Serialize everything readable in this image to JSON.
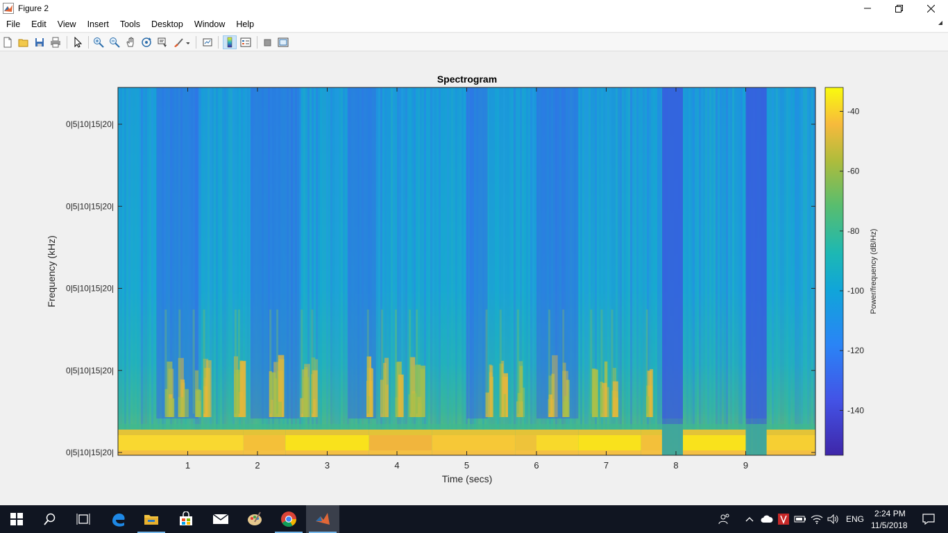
{
  "window": {
    "title": "Figure 2"
  },
  "menu": {
    "items": [
      "File",
      "Edit",
      "View",
      "Insert",
      "Tools",
      "Desktop",
      "Window",
      "Help"
    ]
  },
  "toolbar": {
    "icons": [
      "new-figure-icon",
      "open-file-icon",
      "save-icon",
      "print-icon",
      "select-pointer-icon",
      "zoom-in-icon",
      "zoom-out-icon",
      "pan-icon",
      "rotate-3d-icon",
      "data-cursor-icon",
      "brush-icon",
      "link-plot-icon",
      "colorbar-icon",
      "legend-icon",
      "hide-plot-tools-icon",
      "show-plot-tools-icon"
    ]
  },
  "plot": {
    "title": "Spectrogram",
    "xlabel": "Time (secs)",
    "ylabel": "Frequency (kHz)",
    "ytick_label": "0|5|10|15|20|",
    "colorbar_label": "Power/frequency (dB/Hz)",
    "colors": {
      "low": "#3e26a8",
      "mid": "#0aa9d8",
      "green": "#59bd6e",
      "high": "#f9fb0e"
    }
  },
  "chart_data": {
    "type": "heatmap",
    "title": "Spectrogram",
    "xlabel": "Time (secs)",
    "ylabel": "Frequency (kHz)",
    "x_ticks": [
      1,
      2,
      3,
      4,
      5,
      6,
      7,
      8,
      9
    ],
    "xlim": [
      0,
      10
    ],
    "y_tick_labels": [
      "0|5|10|15|20|",
      "0|5|10|15|20|",
      "0|5|10|15|20|",
      "0|5|10|15|20|",
      "0|5|10|15|20|"
    ],
    "colorbar": {
      "label": "Power/frequency (dB/Hz)",
      "ticks": [
        -40,
        -60,
        -80,
        -100,
        -120,
        -140
      ],
      "range": [
        -155,
        -32
      ]
    },
    "quiet_segments_secs": [
      [
        7.8,
        8.1
      ],
      [
        9.0,
        9.3
      ]
    ],
    "dominant_band": "strong power near 0 kHz across time, bursts of energy around 1.1, 1.7, 2.2, 3.6-4.3, 5.3, 6.2, 6.8-7.1 secs"
  },
  "taskbar": {
    "time": "2:24 PM",
    "date": "11/5/2018",
    "lang": "ENG",
    "icons": [
      "windows-start-icon",
      "search-icon",
      "task-view-icon",
      "edge-icon",
      "file-explorer-icon",
      "store-icon",
      "mail-icon",
      "paint-icon",
      "chrome-icon",
      "matlab-icon"
    ]
  }
}
